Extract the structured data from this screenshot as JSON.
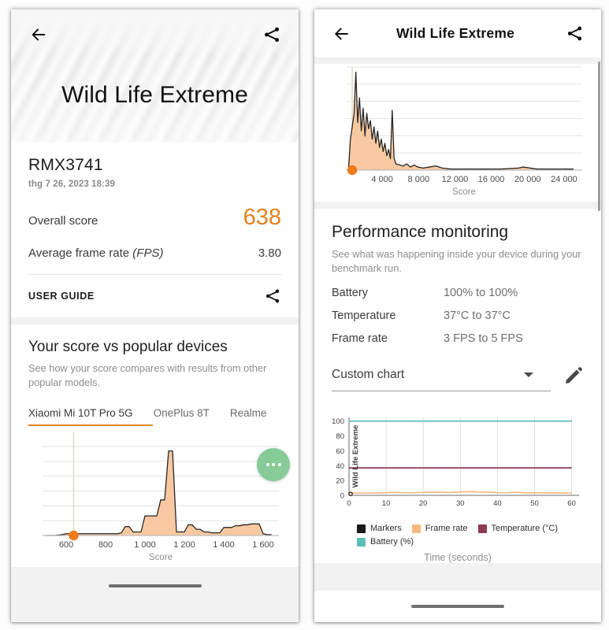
{
  "left_panel": {
    "hero": {
      "title": "Wild Life Extreme",
      "back_icon": "arrow-left-icon",
      "share_icon": "share-icon"
    },
    "result_card": {
      "device_name": "RMX3741",
      "timestamp": "thg 7 26, 2023 18:39",
      "overall_score_label": "Overall score",
      "overall_score_value": "638",
      "fps_label": "Average frame rate ",
      "fps_label_italic": "(FPS)",
      "fps_value": "3.80",
      "user_guide_label": "USER GUIDE"
    },
    "compare_card": {
      "title": "Your score vs popular devices",
      "subtitle": "See how your score compares with results from other popular models.",
      "tabs": [
        {
          "label": "Xiaomi Mi 10T Pro 5G",
          "active": true
        },
        {
          "label": "OnePlus 8T",
          "active": false
        },
        {
          "label": "Realme",
          "active": false
        }
      ]
    },
    "fab_label": "more-options"
  },
  "right_panel": {
    "appbar": {
      "title": "Wild Life Extreme",
      "back_icon": "arrow-left-icon",
      "share_icon": "share-icon"
    },
    "perf_card": {
      "title": "Performance monitoring",
      "subtitle": "See what was happening inside your device during your benchmark run.",
      "rows": [
        {
          "key": "Battery",
          "value": "100% to 100%"
        },
        {
          "key": "Temperature",
          "value": "37°C to 37°C"
        },
        {
          "key": "Frame rate",
          "value": "3 FPS to 5 FPS"
        }
      ],
      "chart_select_value": "Custom chart",
      "edit_icon": "pencil-icon"
    },
    "fab_label": "more-options"
  },
  "colors": {
    "accent_orange": "#E2821F",
    "hist_fill": "#F8C9A0",
    "marker_black": "#1a1a1a",
    "frame_rate": "#F5B97F",
    "temperature": "#8E3A50",
    "battery": "#5CC0B8",
    "fab_green": "#86CB98"
  },
  "chart_data": [
    {
      "id": "left-histogram",
      "type": "area",
      "title": "",
      "xlabel": "Score",
      "ylabel": "",
      "xlim": [
        480,
        1680
      ],
      "ylim": [
        0,
        100
      ],
      "grid": true,
      "xtick_labels": [
        "600",
        "800",
        "1 000",
        "1 200",
        "1 400",
        "1 600"
      ],
      "xticks": [
        600,
        800,
        1000,
        1200,
        1400,
        1600
      ],
      "marker": {
        "x": 638,
        "y": 2,
        "label": "638",
        "color": "#F07B18"
      },
      "x": [
        500,
        540,
        580,
        600,
        620,
        640,
        660,
        700,
        740,
        780,
        820,
        860,
        880,
        900,
        920,
        940,
        960,
        980,
        1000,
        1020,
        1040,
        1060,
        1080,
        1100,
        1120,
        1140,
        1160,
        1180,
        1200,
        1220,
        1240,
        1260,
        1280,
        1300,
        1320,
        1340,
        1360,
        1380,
        1400,
        1420,
        1440,
        1460,
        1480,
        1500,
        1520,
        1540,
        1560,
        1580,
        1600,
        1620,
        1640
      ],
      "values": [
        0,
        0,
        1,
        2,
        2,
        2,
        2,
        2,
        2,
        2,
        2,
        2,
        3,
        10,
        10,
        4,
        4,
        4,
        22,
        22,
        22,
        22,
        40,
        40,
        95,
        95,
        4,
        4,
        4,
        12,
        12,
        7,
        7,
        4,
        4,
        3,
        3,
        3,
        9,
        9,
        9,
        11,
        11,
        12,
        12,
        13,
        13,
        13,
        2,
        1,
        1
      ]
    },
    {
      "id": "right-histogram",
      "type": "area",
      "title": "",
      "xlabel": "Score",
      "ylabel": "",
      "xlim": [
        0,
        26000
      ],
      "ylim": [
        0,
        100
      ],
      "grid": true,
      "xtick_labels": [
        "4 000",
        "8 000",
        "12 000",
        "16 000",
        "20 000",
        "24 000"
      ],
      "xticks": [
        4000,
        8000,
        12000,
        16000,
        20000,
        24000
      ],
      "marker": {
        "x": 700,
        "y": 3,
        "label": "638",
        "color": "#F07B18"
      },
      "x": [
        300,
        500,
        700,
        900,
        1100,
        1300,
        1500,
        1700,
        1900,
        2100,
        2300,
        2500,
        2700,
        2900,
        3100,
        3300,
        3500,
        3700,
        3900,
        4100,
        4300,
        4500,
        4700,
        4900,
        5100,
        5300,
        5500,
        5900,
        6300,
        6700,
        7100,
        7500,
        7900,
        8500,
        9200,
        9900,
        10600,
        11500,
        13000,
        15000,
        17000,
        19000,
        19500,
        21000,
        23000,
        25000
      ],
      "values": [
        2,
        30,
        42,
        55,
        95,
        46,
        70,
        38,
        60,
        33,
        55,
        40,
        48,
        30,
        42,
        26,
        38,
        22,
        30,
        18,
        26,
        14,
        20,
        11,
        58,
        12,
        6,
        5,
        4,
        6,
        3,
        5,
        3,
        2,
        3,
        4,
        2,
        1,
        1,
        1,
        1,
        2,
        3,
        1,
        1,
        1
      ]
    },
    {
      "id": "custom-chart",
      "type": "line",
      "title": "",
      "xlabel": "Time (seconds)",
      "ylabel": "Wild Life Extreme",
      "xlim": [
        0,
        62
      ],
      "ylim": [
        0,
        105
      ],
      "xticks": [
        0,
        10,
        20,
        30,
        40,
        50,
        60
      ],
      "xtick_labels": [
        "0",
        "10",
        "20",
        "30",
        "40",
        "50",
        "60"
      ],
      "yticks": [
        0,
        20,
        40,
        60,
        80,
        100
      ],
      "ytick_labels": [
        "0",
        "20",
        "40",
        "60",
        "80",
        "100"
      ],
      "grid": true,
      "legend_position": "bottom",
      "legend": [
        {
          "name": "Markers",
          "color": "#1a1a1a"
        },
        {
          "name": "Frame rate",
          "color": "#F5B97F"
        },
        {
          "name": "Temperature (°C)",
          "color": "#8E3A50"
        },
        {
          "name": "Battery (%)",
          "color": "#5CC0B8"
        }
      ],
      "series": [
        {
          "name": "Battery (%)",
          "color": "#5CC0B8",
          "x": [
            0,
            60
          ],
          "values": [
            100,
            100
          ]
        },
        {
          "name": "Temperature (°C)",
          "color": "#8E3A50",
          "x": [
            0,
            60
          ],
          "values": [
            37,
            37
          ]
        },
        {
          "name": "Frame rate",
          "color": "#F5B97F",
          "x": [
            0,
            3,
            6,
            9,
            12,
            15,
            18,
            21,
            24,
            27,
            30,
            33,
            36,
            39,
            42,
            45,
            48,
            51,
            54,
            57,
            60
          ],
          "values": [
            3,
            3,
            3,
            3.4,
            4,
            3.6,
            3.5,
            4.2,
            4.3,
            3.8,
            4.5,
            5,
            4.4,
            3.9,
            3.5,
            4.1,
            3.3,
            3.6,
            3.2,
            3.4,
            3
          ]
        }
      ]
    }
  ]
}
